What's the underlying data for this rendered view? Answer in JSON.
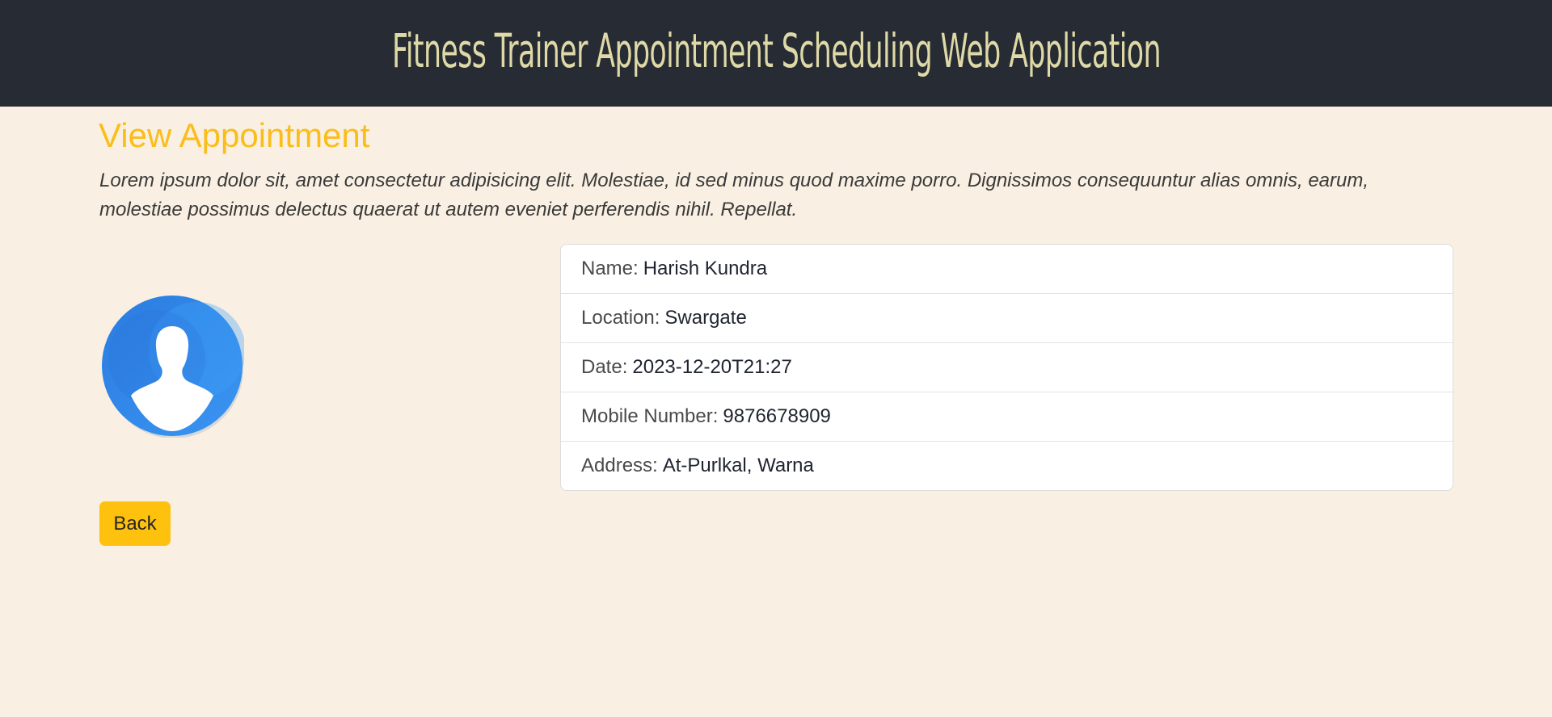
{
  "header": {
    "title": "Fitness Trainer Appointment Scheduling Web Application"
  },
  "page": {
    "title": "View Appointment",
    "intro": "Lorem ipsum dolor sit, amet consectetur adipisicing elit. Molestiae, id sed minus quod maxime porro. Dignissimos consequuntur alias omnis, earum, molestiae possimus delectus quaerat ut autem eveniet perferendis nihil. Repellat."
  },
  "avatar": {
    "icon": "user-profile-icon",
    "color": "#2f86ec"
  },
  "details": [
    {
      "label": "Name:",
      "value": "Harish Kundra"
    },
    {
      "label": "Location:",
      "value": "Swargate"
    },
    {
      "label": "Date:",
      "value": "2023-12-20T21:27"
    },
    {
      "label": "Mobile Number:",
      "value": "9876678909"
    },
    {
      "label": "Address:",
      "value": "At-Purlkal, Warna"
    }
  ],
  "actions": {
    "back_label": "Back"
  },
  "colors": {
    "header_bg": "#272b34",
    "header_text": "#ded9a6",
    "page_bg": "#f9f0e3",
    "accent": "#fbbd1a",
    "button_bg": "#fdc10e"
  }
}
